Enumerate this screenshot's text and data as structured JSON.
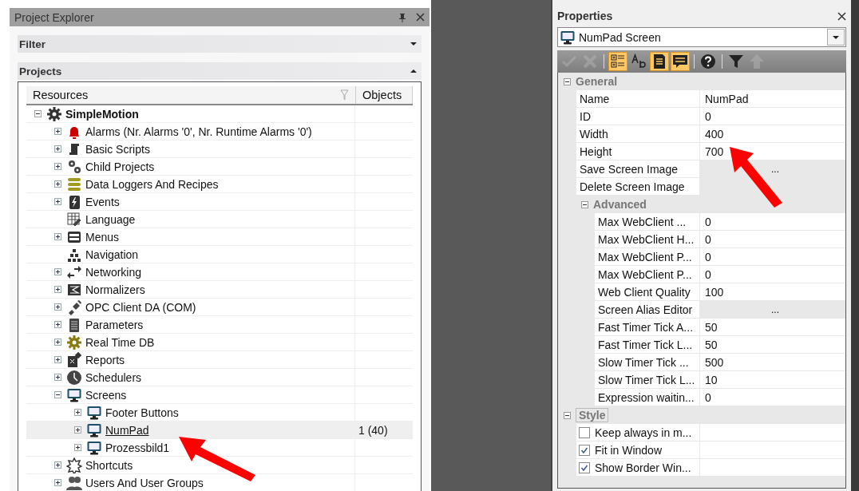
{
  "explorer": {
    "title": "Project Explorer",
    "filter": {
      "label": "Filter",
      "expanded": false
    },
    "projects": {
      "label": "Projects",
      "expanded": true
    },
    "columns": [
      "Resources",
      "Objects"
    ],
    "tree": [
      {
        "label": "SimpleMotion",
        "expandable": true,
        "expanded": true,
        "selected": false,
        "children": [
          {
            "label": "Alarms (Nr. Alarms '0', Nr. Runtime Alarms '0')",
            "expandable": true,
            "expanded": false,
            "selected": false
          },
          {
            "label": "Basic Scripts",
            "expandable": true,
            "expanded": false,
            "selected": false
          },
          {
            "label": "Child Projects",
            "expandable": true,
            "expanded": false,
            "selected": false
          },
          {
            "label": "Data Loggers And Recipes",
            "expandable": true,
            "expanded": false,
            "selected": false
          },
          {
            "label": "Events",
            "expandable": true,
            "expanded": false,
            "selected": false
          },
          {
            "label": "Language",
            "expandable": false,
            "selected": false
          },
          {
            "label": "Menus",
            "expandable": true,
            "expanded": false,
            "selected": false
          },
          {
            "label": "Navigation",
            "expandable": false,
            "selected": false
          },
          {
            "label": "Networking",
            "expandable": true,
            "expanded": false,
            "selected": false
          },
          {
            "label": "Normalizers",
            "expandable": true,
            "expanded": false,
            "selected": false
          },
          {
            "label": "OPC Client DA (COM)",
            "expandable": true,
            "expanded": false,
            "selected": false
          },
          {
            "label": "Parameters",
            "expandable": true,
            "expanded": false,
            "selected": false
          },
          {
            "label": "Real Time DB",
            "expandable": true,
            "expanded": false,
            "selected": false
          },
          {
            "label": "Reports",
            "expandable": true,
            "expanded": false,
            "selected": false
          },
          {
            "label": "Schedulers",
            "expandable": true,
            "expanded": false,
            "selected": false
          },
          {
            "label": "Screens",
            "expandable": true,
            "expanded": true,
            "selected": false,
            "children": [
              {
                "label": "Footer Buttons",
                "expandable": true,
                "expanded": false,
                "selected": false
              },
              {
                "label": "NumPad",
                "expandable": true,
                "expanded": false,
                "selected": true,
                "objects": "1 (40)"
              },
              {
                "label": "Prozessbild1",
                "expandable": true,
                "expanded": false,
                "selected": false
              }
            ]
          },
          {
            "label": "Shortcuts",
            "expandable": true,
            "expanded": false,
            "selected": false
          },
          {
            "label": "Users And User Groups",
            "expandable": true,
            "expanded": false,
            "selected": false
          }
        ]
      }
    ]
  },
  "properties": {
    "title": "Properties",
    "object": "NumPad Screen",
    "toolbar": [
      {
        "selected": false,
        "disabled": true
      },
      {
        "selected": false,
        "disabled": true
      },
      {
        "selected": true,
        "disabled": false
      },
      {
        "selected": false,
        "disabled": false
      },
      {
        "selected": true,
        "disabled": false
      },
      {
        "selected": true,
        "disabled": false
      },
      {
        "selected": false,
        "disabled": false
      },
      {
        "selected": false,
        "disabled": false
      },
      {
        "selected": false,
        "disabled": true
      }
    ],
    "categories": [
      {
        "label": "General",
        "expanded": true,
        "rows": [
          {
            "kind": "text",
            "label": "Name",
            "value": "NumPad"
          },
          {
            "kind": "text",
            "label": "ID",
            "value": "0"
          },
          {
            "kind": "text",
            "label": "Width",
            "value": "400"
          },
          {
            "kind": "text",
            "label": "Height",
            "value": "700"
          },
          {
            "kind": "button",
            "label": "Save Screen Image",
            "value": "..."
          },
          {
            "kind": "button",
            "label": "Delete Screen Image"
          }
        ],
        "subcategories": [
          {
            "label": "Advanced",
            "expanded": true,
            "rows": [
              {
                "kind": "text",
                "label": "Max WebClient ...",
                "value": "0"
              },
              {
                "kind": "text",
                "label": "Max WebClient H...",
                "value": "0"
              },
              {
                "kind": "text",
                "label": "Max WebClient P...",
                "value": "0"
              },
              {
                "kind": "text",
                "label": "Max WebClient P...",
                "value": "0"
              },
              {
                "kind": "text",
                "label": "Web Client Quality",
                "value": "100"
              },
              {
                "kind": "button",
                "label": "Screen Alias Editor",
                "value": "..."
              },
              {
                "kind": "text",
                "label": "Fast Timer Tick A...",
                "value": "50"
              },
              {
                "kind": "text",
                "label": "Fast Timer Tick L...",
                "value": "50"
              },
              {
                "kind": "text",
                "label": "Slow Timer Tick ...",
                "value": "500"
              },
              {
                "kind": "text",
                "label": "Slow Timer Tick L...",
                "value": "10"
              },
              {
                "kind": "text",
                "label": "Expression waitin...",
                "value": "0"
              }
            ]
          }
        ]
      },
      {
        "label": "Style",
        "expanded": true,
        "rows": [
          {
            "kind": "checkbox",
            "label": "Keep always in m...",
            "checked": false
          },
          {
            "kind": "checkbox",
            "label": "Fit in Window",
            "checked": true
          },
          {
            "kind": "checkbox",
            "label": "Show Border Win...",
            "checked": true
          }
        ]
      }
    ]
  }
}
